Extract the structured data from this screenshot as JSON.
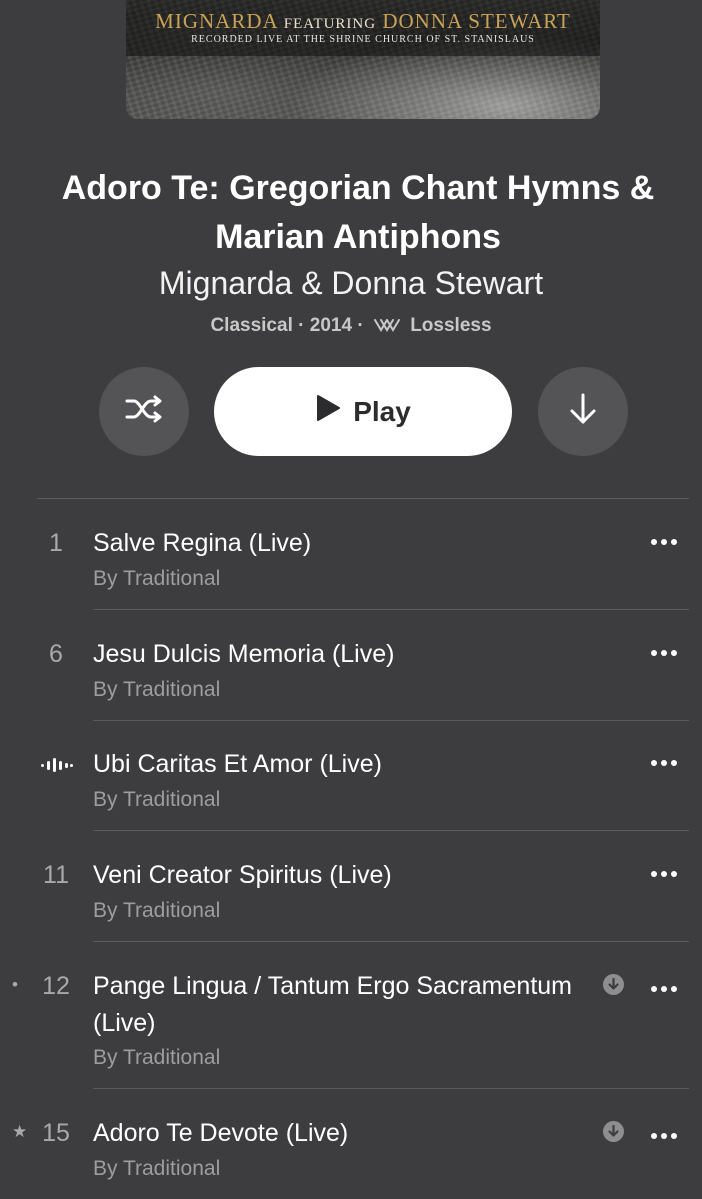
{
  "album_art": {
    "artist_name": "Mignarda",
    "featuring_label": "Featuring",
    "featured_name": "Donna Stewart",
    "subtitle": "RECORDED LIVE AT THE SHRINE CHURCH OF ST. STANISLAUS"
  },
  "album": {
    "title": "Adoro Te: Gregorian Chant Hymns & Marian Antiphons",
    "artist": "Mignarda & Donna Stewart",
    "genre": "Classical",
    "year": "2014",
    "quality": "Lossless",
    "separator": "·"
  },
  "controls": {
    "shuffle_icon": "shuffle-icon",
    "play_label": "Play",
    "download_icon": "download-arrow-icon"
  },
  "tracks": [
    {
      "number": "1",
      "title": "Salve Regina (Live)",
      "artist": "By Traditional",
      "leader": "",
      "downloaded": false,
      "playing": false
    },
    {
      "number": "6",
      "title": "Jesu Dulcis Memoria (Live)",
      "artist": "By Traditional",
      "leader": "",
      "downloaded": false,
      "playing": false
    },
    {
      "number": "",
      "title": "Ubi Caritas Et Amor (Live)",
      "artist": "By Traditional",
      "leader": "",
      "downloaded": false,
      "playing": true
    },
    {
      "number": "11",
      "title": "Veni Creator Spiritus (Live)",
      "artist": "By Traditional",
      "leader": "",
      "downloaded": false,
      "playing": false
    },
    {
      "number": "12",
      "title": "Pange Lingua / Tantum Ergo Sacramentum (Live)",
      "artist": "By Traditional",
      "leader": "•",
      "downloaded": true,
      "playing": false
    },
    {
      "number": "15",
      "title": "Adoro Te Devote (Live)",
      "artist": "By Traditional",
      "leader": "★",
      "downloaded": true,
      "playing": false
    }
  ],
  "colors": {
    "background": "#3d3d3f",
    "secondary_text": "#9d9d9f",
    "button_fill": "#545456",
    "art_gold": "#c8a257"
  }
}
